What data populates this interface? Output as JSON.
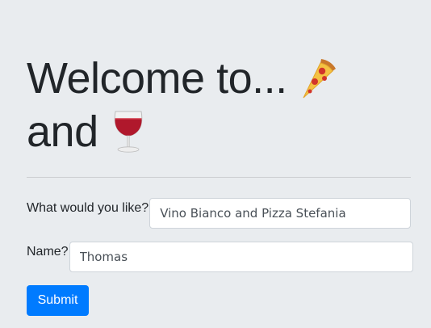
{
  "heading": {
    "line1": "Welcome to...",
    "line2": "and",
    "icon1": "pizza-slice-icon",
    "icon2": "wine-glass-icon"
  },
  "form": {
    "order_label": "What would you like?",
    "order_value": "Vino Bianco and Pizza Stefania",
    "name_label": "Name?",
    "name_value": "Thomas",
    "submit_label": "Submit"
  },
  "colors": {
    "background": "#e9ecef",
    "text": "#212529",
    "button": "#007bff",
    "button_text": "#ffffff"
  }
}
